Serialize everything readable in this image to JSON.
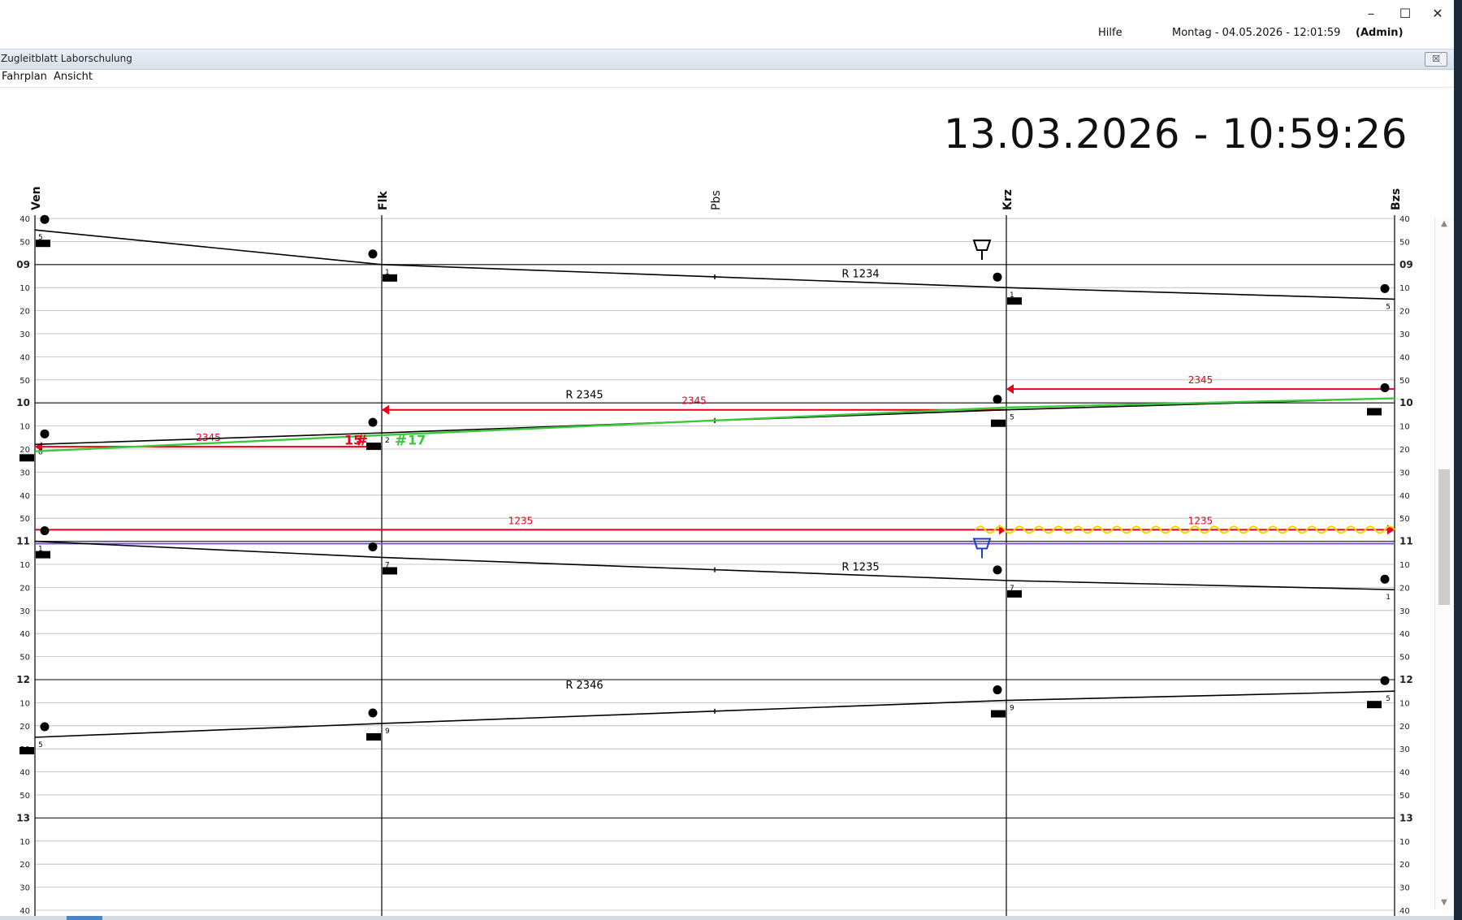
{
  "window": {
    "help_label": "Hilfe",
    "datetime_label": "Montag - 04.05.2026 - 12:01:59",
    "user_label": "(Admin)",
    "minimize_glyph": "–",
    "maximize_glyph": "☐",
    "close_glyph": "✕"
  },
  "app": {
    "title": "Zugleitblatt Laborschulung",
    "close_glyph": "☒",
    "menu": [
      "Fahrplan",
      "Ansicht"
    ]
  },
  "clock": "13.03.2026 - 10:59:26",
  "stations": [
    {
      "code": "Ven",
      "bold": true
    },
    {
      "code": "Flk",
      "bold": true
    },
    {
      "code": "Pbs",
      "bold": false
    },
    {
      "code": "Krz",
      "bold": true
    },
    {
      "code": "Bzs",
      "bold": true
    }
  ],
  "time_axis": {
    "start": "08:40",
    "end": "13:40",
    "step_minutes": 10,
    "hour_labels": [
      "09",
      "10",
      "11",
      "12",
      "13"
    ],
    "minute_labels": [
      "40",
      "50",
      "10",
      "20",
      "30",
      "40",
      "50"
    ]
  },
  "trains": [
    {
      "label": "R 1234",
      "stops": [
        {
          "s": "Ven",
          "t": "08:45"
        },
        {
          "s": "Flk",
          "t": "09:00"
        },
        {
          "s": "Krz",
          "t": "09:10"
        },
        {
          "s": "Bzs",
          "t": "09:15"
        }
      ],
      "tracks": [
        {
          "s": "Ven",
          "n": "5"
        },
        {
          "s": "Flk",
          "n": "1"
        },
        {
          "s": "Krz",
          "n": "1"
        },
        {
          "s": "Bzs",
          "n": "5"
        }
      ]
    },
    {
      "label": "R 2345",
      "stops": [
        {
          "s": "Ven",
          "t": "10:18"
        },
        {
          "s": "Flk",
          "t": "10:13"
        },
        {
          "s": "Krz",
          "t": "10:03"
        },
        {
          "s": "Bzs",
          "t": "09:58"
        }
      ],
      "tracks": [
        {
          "s": "Ven",
          "n": "8"
        },
        {
          "s": "Flk",
          "n": "2"
        },
        {
          "s": "Krz",
          "n": "5"
        }
      ]
    },
    {
      "label": "R 1235",
      "stops": [
        {
          "s": "Ven",
          "t": "11:00"
        },
        {
          "s": "Flk",
          "t": "11:07"
        },
        {
          "s": "Krz",
          "t": "11:17"
        },
        {
          "s": "Bzs",
          "t": "11:21"
        }
      ],
      "tracks": [
        {
          "s": "Ven",
          "n": "1"
        },
        {
          "s": "Flk",
          "n": "7"
        },
        {
          "s": "Krz",
          "n": "7"
        },
        {
          "s": "Bzs",
          "n": "1"
        }
      ]
    },
    {
      "label": "R 2346",
      "stops": [
        {
          "s": "Ven",
          "t": "12:25"
        },
        {
          "s": "Flk",
          "t": "12:19"
        },
        {
          "s": "Krz",
          "t": "12:09"
        },
        {
          "s": "Bzs",
          "t": "12:05"
        }
      ],
      "tracks": [
        {
          "s": "Ven",
          "n": "5"
        },
        {
          "s": "Flk",
          "n": "9"
        },
        {
          "s": "Krz",
          "n": "9"
        },
        {
          "s": "Bzs",
          "n": "5"
        }
      ]
    }
  ],
  "actual_run": {
    "color": "#3cc83c",
    "points": [
      {
        "s": "Ven",
        "t": "10:21"
      },
      {
        "s": "Flk",
        "t": "10:14"
      },
      {
        "s": "Krz",
        "t": "10:02"
      },
      {
        "s": "Bzs",
        "t": "09:58"
      }
    ],
    "markers": [
      {
        "label": "15",
        "color": "#e8001c"
      },
      {
        "label": "17",
        "color": "#3cc83c"
      }
    ]
  },
  "orders": [
    {
      "label": "2345",
      "from": "Bzs",
      "to": "Krz",
      "t": "09:54"
    },
    {
      "label": "2345",
      "from": "Krz",
      "to": "Flk",
      "t": "10:03"
    },
    {
      "label": "2345",
      "from": "Flk",
      "to": "Ven",
      "t": "10:19"
    },
    {
      "label": "1235",
      "from": "Ven",
      "to": "Krz",
      "t": "10:55"
    },
    {
      "label": "1235",
      "from": "Krz",
      "to": "Bzs",
      "t": "10:55"
    }
  ],
  "colors": {
    "order": "#e8001c",
    "wave": "#f2d400",
    "now_line": "#7e5bd0",
    "grid": "#b8b8b8",
    "train": "#000000",
    "signal_blue": "#1f3fbf"
  }
}
